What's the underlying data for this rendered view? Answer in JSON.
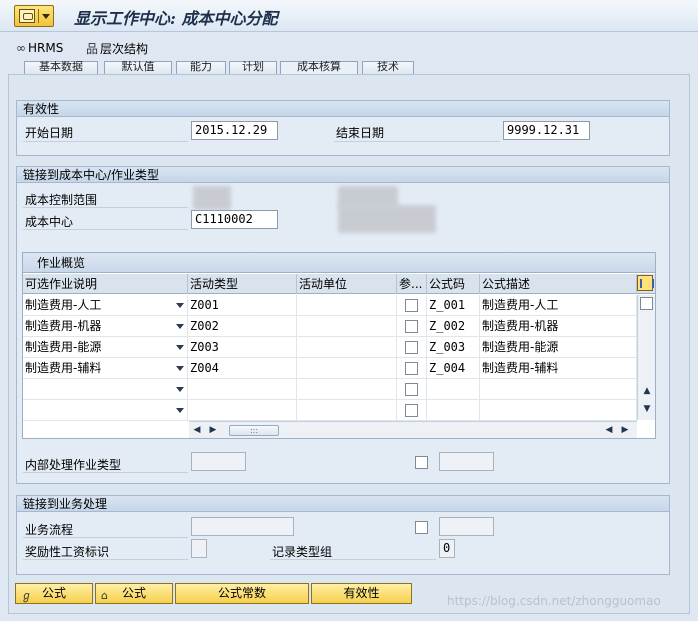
{
  "window": {
    "title": "显示工作中心: 成本中心分配"
  },
  "toolbar": {
    "hrms_label": "HRMS",
    "hierarchy_label": "层次结构"
  },
  "tabs": [
    {
      "label": "基本数据"
    },
    {
      "label": "默认值"
    },
    {
      "label": "能力"
    },
    {
      "label": "计划"
    },
    {
      "label": "成本核算"
    },
    {
      "label": "技术"
    }
  ],
  "validity": {
    "header": "有效性",
    "start_label": "开始日期",
    "start_value": "2015.12.29",
    "end_label": "结束日期",
    "end_value": "9999.12.31"
  },
  "link_cost_center": {
    "header": "链接到成本中心/作业类型",
    "controlling_area_label": "成本控制范围",
    "cost_center_label": "成本中心",
    "cost_center_value": "C1110002"
  },
  "activity_table": {
    "title": "作业概览",
    "columns": [
      "可选作业说明",
      "活动类型",
      "活动单位",
      "参...",
      "公式码",
      "公式描述"
    ],
    "rows": [
      {
        "desc": "制造费用-人工",
        "type": "Z001",
        "unit": "",
        "formula_key": "Z_001",
        "formula_desc": "制造费用-人工"
      },
      {
        "desc": "制造费用-机器",
        "type": "Z002",
        "unit": "",
        "formula_key": "Z_002",
        "formula_desc": "制造费用-机器"
      },
      {
        "desc": "制造费用-能源",
        "type": "Z003",
        "unit": "",
        "formula_key": "Z_003",
        "formula_desc": "制造费用-能源"
      },
      {
        "desc": "制造费用-辅料",
        "type": "Z004",
        "unit": "",
        "formula_key": "Z_004",
        "formula_desc": "制造费用-辅料"
      },
      {
        "desc": "",
        "type": "",
        "unit": "",
        "formula_key": "",
        "formula_desc": ""
      },
      {
        "desc": "",
        "type": "",
        "unit": "",
        "formula_key": "",
        "formula_desc": ""
      }
    ],
    "internal_label": "内部处理作业类型"
  },
  "link_business": {
    "header": "链接到业务处理",
    "process_label": "业务流程",
    "incentive_label": "奖励性工资标识",
    "record_group_label": "记录类型组",
    "record_group_value": "0"
  },
  "buttons": {
    "formula1": "公式",
    "formula2": "公式",
    "formula_constants": "公式常数",
    "validity": "有效性"
  },
  "watermark": "https://blog.csdn.net/zhongguomao"
}
